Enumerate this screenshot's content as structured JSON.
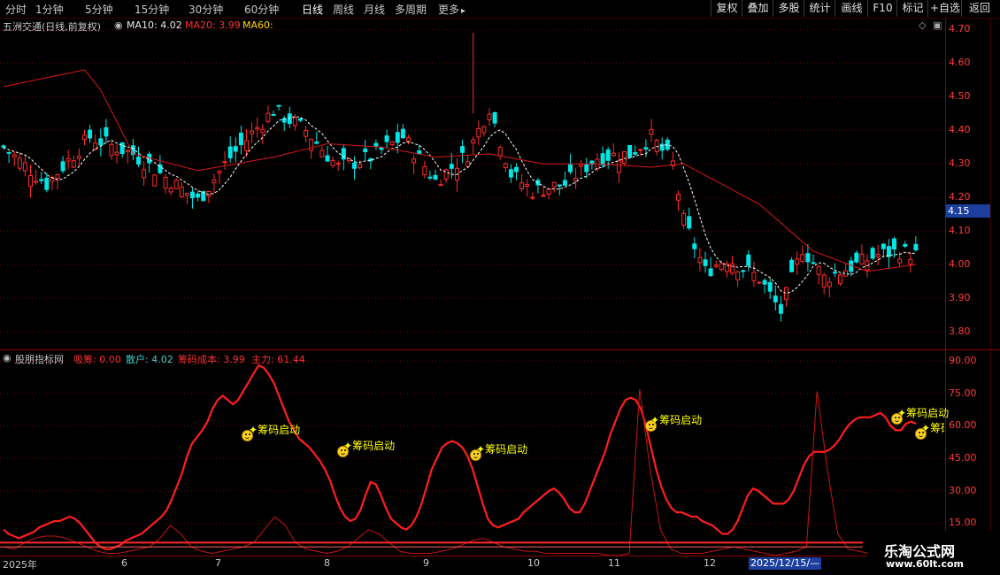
{
  "toolbar": {
    "timeframes": [
      "分时",
      "1分钟",
      "5分钟",
      "15分钟",
      "30分钟",
      "60分钟",
      "日线",
      "周线",
      "月线",
      "多周期",
      "更多"
    ],
    "more_icon": "chevron-right-icon",
    "buttons": [
      "复权",
      "叠加",
      "多股",
      "统计",
      "画线",
      "F10",
      "标记",
      "+自选",
      "返回"
    ]
  },
  "main_chart": {
    "stock": "五洲交通(日线,前复权)",
    "ma10": "MA10: 4.02",
    "ma20": "MA20: 3.99",
    "ma60": "MA60:",
    "price_ticks": [
      "4.70",
      "4.60",
      "4.50",
      "4.40",
      "4.30",
      "4.20",
      "4.10",
      "4.00",
      "3.90",
      "3.80"
    ],
    "current_price": "4.15",
    "ylim": [
      3.75,
      4.73
    ]
  },
  "indicator": {
    "name": "股朋指标网",
    "xichou": "吸筹: 0.00",
    "sanhu": "散户: 4.02",
    "cost": "筹码成本: 3.99",
    "zhuli": "主力: 61.44",
    "ticks": [
      "90.00",
      "75.00",
      "60.00",
      "45.00",
      "30.00",
      "15.00"
    ],
    "signal_label": "筹码启动",
    "signal_label_cut": "筹码"
  },
  "dates": [
    "2025年",
    "6",
    "7",
    "8",
    "9",
    "10",
    "11",
    "12"
  ],
  "cursor_date": "2025/12/15/—",
  "watermark": {
    "title": "乐淘公式网",
    "url": "www.60lt.com"
  },
  "chart_data": {
    "type": "line",
    "series": [
      {
        "name": "主力",
        "values": [
          12,
          10,
          9,
          8,
          9,
          10,
          11,
          13,
          14,
          15,
          16,
          16,
          17,
          18,
          17,
          15,
          12,
          9,
          6,
          4,
          3,
          3,
          4,
          5,
          7,
          8,
          9,
          10,
          12,
          14,
          16,
          18,
          21,
          26,
          32,
          38,
          46,
          52,
          55,
          58,
          62,
          68,
          72,
          74,
          72,
          70,
          72,
          76,
          80,
          84,
          88,
          87,
          84,
          80,
          74,
          68,
          62,
          58,
          54,
          52,
          50,
          47,
          44,
          40,
          35,
          28,
          22,
          18,
          16,
          17,
          21,
          28,
          34,
          33,
          28,
          22,
          17,
          15,
          13,
          12,
          14,
          18,
          24,
          32,
          40,
          45,
          50,
          52,
          53,
          52,
          50,
          46,
          40,
          32,
          24,
          17,
          14,
          13,
          14,
          15,
          16,
          17,
          20,
          22,
          24,
          26,
          28,
          30,
          31,
          29,
          26,
          22,
          20,
          20,
          24,
          30,
          36,
          42,
          48,
          56,
          62,
          68,
          72,
          73,
          72,
          68,
          60,
          50,
          40,
          32,
          26,
          22,
          20,
          20,
          19,
          18,
          18,
          16,
          15,
          14,
          12,
          10,
          10,
          12,
          16,
          22,
          28,
          31,
          30,
          28,
          26,
          24,
          24,
          24,
          26,
          30,
          36,
          42,
          46,
          48,
          48,
          48,
          49,
          51,
          54,
          58,
          61,
          63,
          64,
          64,
          64,
          65,
          66,
          64,
          60,
          58,
          58,
          61,
          62,
          61
        ]
      },
      {
        "name": "吸筹",
        "values": [
          0,
          0,
          0,
          0,
          0,
          0,
          0,
          0,
          0,
          0,
          0,
          0,
          0,
          0,
          0,
          0,
          0,
          0,
          0,
          0,
          0,
          0,
          0,
          0,
          0,
          0,
          0,
          0,
          0,
          0,
          0,
          0,
          0,
          0,
          0,
          0,
          0,
          0,
          0,
          0,
          0,
          0,
          0,
          0,
          0,
          0,
          0,
          0,
          0,
          0,
          0,
          0,
          0,
          0,
          0,
          0,
          0,
          0,
          0,
          0,
          0,
          0,
          0,
          0,
          0,
          0,
          0,
          0,
          0,
          0,
          0,
          0,
          0,
          0,
          0,
          0,
          0,
          0,
          0,
          0,
          0,
          0,
          0,
          0,
          0,
          0,
          0,
          0,
          0,
          0,
          0,
          0,
          0,
          0,
          0,
          0,
          0,
          0,
          0,
          0,
          0,
          0,
          0,
          0,
          0,
          0,
          0,
          0,
          0,
          0,
          0,
          0,
          0,
          0,
          0,
          0,
          0,
          0,
          0,
          0,
          0,
          0,
          0,
          0,
          0,
          0,
          0,
          0,
          0,
          77,
          50,
          10,
          0,
          0,
          0,
          0,
          0,
          0,
          0,
          0,
          0,
          0,
          0,
          0,
          0,
          0,
          0,
          0,
          0,
          0,
          0,
          0,
          0,
          0,
          0,
          0,
          0,
          0,
          0,
          0,
          0,
          0,
          0,
          0,
          0,
          0,
          0,
          0,
          0,
          0,
          0,
          0,
          0,
          0,
          0,
          0,
          0,
          0,
          0,
          0,
          0,
          0,
          0,
          0,
          0,
          0,
          0,
          0,
          0,
          0
        ]
      }
    ],
    "ylim": [
      0,
      95
    ],
    "grid": true
  }
}
